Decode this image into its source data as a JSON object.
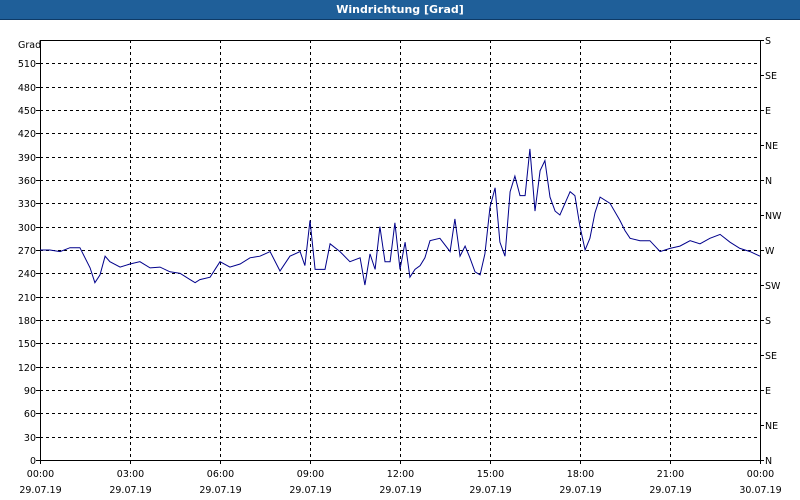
{
  "window": {
    "title": "Windrichtung [Grad]"
  },
  "chart_data": {
    "type": "line",
    "title": "Windrichtung [Grad]",
    "ylabel": "Grad",
    "ylim": [
      0,
      540
    ],
    "yticks": [
      0,
      30,
      60,
      90,
      120,
      150,
      180,
      210,
      240,
      270,
      300,
      330,
      360,
      390,
      420,
      450,
      480,
      510
    ],
    "y2_labels": [
      {
        "value": 0,
        "label": "N"
      },
      {
        "value": 45,
        "label": "NE"
      },
      {
        "value": 90,
        "label": "E"
      },
      {
        "value": 135,
        "label": "SE"
      },
      {
        "value": 180,
        "label": "S"
      },
      {
        "value": 225,
        "label": "SW"
      },
      {
        "value": 270,
        "label": "W"
      },
      {
        "value": 315,
        "label": "NW"
      },
      {
        "value": 360,
        "label": "N"
      },
      {
        "value": 405,
        "label": "NE"
      },
      {
        "value": 450,
        "label": "E"
      },
      {
        "value": 495,
        "label": "SE"
      },
      {
        "value": 540,
        "label": "S"
      }
    ],
    "xlim": [
      0,
      24
    ],
    "xticks": [
      {
        "value": 0,
        "time": "00:00",
        "date": "29.07.19"
      },
      {
        "value": 3,
        "time": "03:00",
        "date": "29.07.19"
      },
      {
        "value": 6,
        "time": "06:00",
        "date": "29.07.19"
      },
      {
        "value": 9,
        "time": "09:00",
        "date": "29.07.19"
      },
      {
        "value": 12,
        "time": "12:00",
        "date": "29.07.19"
      },
      {
        "value": 15,
        "time": "15:00",
        "date": "29.07.19"
      },
      {
        "value": 18,
        "time": "18:00",
        "date": "29.07.19"
      },
      {
        "value": 21,
        "time": "21:00",
        "date": "29.07.19"
      },
      {
        "value": 24,
        "time": "00:00",
        "date": "30.07.19"
      }
    ],
    "grid": true,
    "colors": {
      "line": "#00008b",
      "grid": "#000000",
      "title_bar": "#1f5f99"
    },
    "series": [
      {
        "x": [
          0,
          0.33,
          0.67,
          1.0,
          1.33,
          1.67,
          1.83,
          2.0,
          2.17,
          2.33,
          2.67,
          3.0,
          3.33,
          3.67,
          4.0,
          4.33,
          4.67,
          5.0,
          5.17,
          5.33,
          5.67,
          6.0,
          6.33,
          6.67,
          7.0,
          7.33,
          7.67,
          8.0,
          8.33,
          8.67,
          8.83,
          9.0,
          9.17,
          9.5,
          9.67,
          10.0,
          10.33,
          10.67,
          10.83,
          11.0,
          11.17,
          11.33,
          11.5,
          11.67,
          11.83,
          12.0,
          12.17,
          12.33,
          12.5,
          12.67,
          12.83,
          13.0,
          13.33,
          13.67,
          13.83,
          14.0,
          14.17,
          14.33,
          14.5,
          14.67,
          14.83,
          15.0,
          15.17,
          15.33,
          15.5,
          15.67,
          15.83,
          16.0,
          16.17,
          16.33,
          16.5,
          16.67,
          16.83,
          17.0,
          17.17,
          17.33,
          17.5,
          17.67,
          17.83,
          18.0,
          18.17,
          18.33,
          18.5,
          18.67,
          19.0,
          19.33,
          19.5,
          19.67,
          20.0,
          20.33,
          20.67,
          21.0,
          21.33,
          21.67,
          22.0,
          22.33,
          22.67,
          23.0,
          23.33,
          23.67,
          24.0
        ],
        "values": [
          270,
          270,
          268,
          273,
          273,
          247,
          228,
          238,
          262,
          255,
          248,
          252,
          255,
          247,
          248,
          242,
          240,
          232,
          228,
          232,
          235,
          255,
          248,
          252,
          260,
          262,
          268,
          243,
          262,
          268,
          250,
          308,
          245,
          245,
          278,
          268,
          255,
          260,
          225,
          265,
          245,
          300,
          255,
          255,
          305,
          245,
          280,
          235,
          245,
          250,
          260,
          282,
          285,
          268,
          310,
          262,
          275,
          260,
          242,
          238,
          265,
          325,
          350,
          280,
          262,
          345,
          365,
          340,
          340,
          400,
          320,
          372,
          385,
          338,
          320,
          315,
          330,
          345,
          340,
          300,
          270,
          285,
          318,
          338,
          330,
          308,
          295,
          285,
          282,
          282,
          268,
          272,
          275,
          282,
          278,
          285,
          290,
          280,
          272,
          268,
          262
        ]
      }
    ]
  }
}
